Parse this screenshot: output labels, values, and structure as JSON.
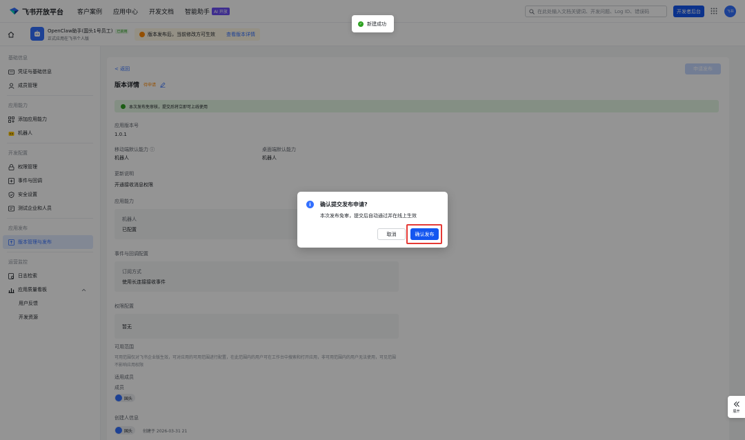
{
  "topnav": {
    "brand": "飞书开放平台",
    "items": [
      "客户案例",
      "应用中心",
      "开发文档",
      "智能助手"
    ],
    "ai_badge": "AI 开放",
    "search_placeholder": "在此处输入文档关键词、开发问题、Log ID、错误码",
    "dev_console": "开发者后台",
    "avatar_text": "飞书"
  },
  "appbar": {
    "app_name": "OpenClaw助手(国头1号员工)",
    "online_tag": "已启用",
    "app_sub": "正式应用在飞书个人版",
    "notice": "版本发布后，当前修改方可生效",
    "notice_link": "查看版本详情"
  },
  "sidebar": {
    "groups": [
      {
        "title": "基础信息",
        "items": [
          {
            "label": "凭证与基础信息",
            "icon": "id-card-icon"
          },
          {
            "label": "成员管理",
            "icon": "user-icon"
          }
        ]
      },
      {
        "title": "应用能力",
        "items": [
          {
            "label": "添加应用能力",
            "icon": "add-grid-icon"
          },
          {
            "label": "机器人",
            "icon": "robot-icon"
          }
        ]
      },
      {
        "title": "开发配置",
        "items": [
          {
            "label": "权限管理",
            "icon": "lock-icon"
          },
          {
            "label": "事件与回调",
            "icon": "event-icon"
          },
          {
            "label": "安全设置",
            "icon": "shield-icon"
          },
          {
            "label": "测试企业和人员",
            "icon": "test-icon"
          }
        ]
      },
      {
        "title": "应用发布",
        "items": [
          {
            "label": "版本管理与发布",
            "icon": "version-icon",
            "active": true
          }
        ]
      },
      {
        "title": "运营监控",
        "items": [
          {
            "label": "日志检索",
            "icon": "log-icon"
          },
          {
            "label": "应用质量看板",
            "icon": "dashboard-icon"
          },
          {
            "label": "用户反馈",
            "sub": true
          },
          {
            "label": "开发资源",
            "sub": true
          }
        ]
      }
    ]
  },
  "main": {
    "back": "< 返回",
    "title": "版本详情",
    "status": "待申请",
    "submit": "申请发布",
    "banner": "本次发布免审核，提交后将立即可上线使用",
    "fields": {
      "version_label": "应用版本号",
      "version_value": "1.0.1",
      "mobile_label": "移动端默认能力 ⓘ",
      "mobile_value": "机器人",
      "desktop_label": "桌面端默认能力",
      "desktop_value": "机器人",
      "update_label": "更新说明",
      "update_value": "开通接收消息权限",
      "cap_label": "应用能力",
      "robot_label": "机器人",
      "robot_value": "已配置",
      "event_label": "事件与回调配置",
      "sub_label": "订阅方式",
      "sub_value": "使用长连接接收事件",
      "perm_label": "权限配置",
      "perm_value": "暂无",
      "avail_label": "可用范围",
      "avail_desc": "可用范围仅对飞书企业版生效，可对应用的可用范围进行配置，在此范围内的用户可在工作台中搜索和打开应用，非可用范围内的用户无法使用，可见范围不影响应用权限",
      "avail_member_label": "适用成员",
      "avail_member_value": "成员",
      "avail_user": "国头",
      "creator_label": "创建人信息",
      "creator_user": "国头",
      "creator_time": "创建于 2026-03-31 21"
    }
  },
  "toast": "新建成功",
  "dialog": {
    "icon": "i",
    "title": "确认提交发布申请?",
    "body": "本次发布免审，提交后自动通过并在线上生效",
    "cancel": "取消",
    "confirm": "确认发布"
  },
  "expand": {
    "label": "展开"
  }
}
